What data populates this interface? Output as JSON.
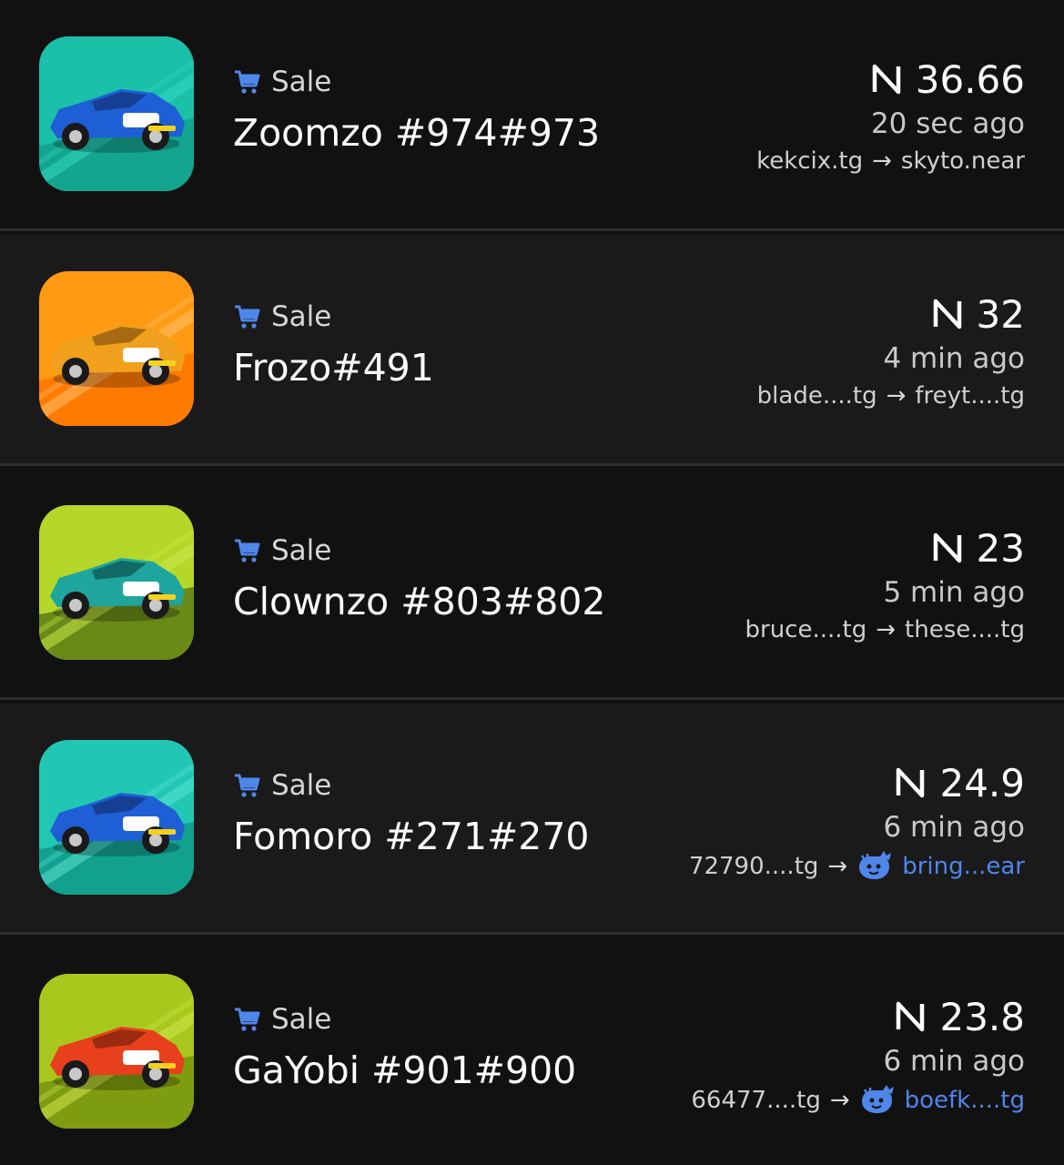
{
  "activity": {
    "items": [
      {
        "type_label": "Sale",
        "name": "Zoomzo #974#973",
        "price": "36.66",
        "time": "20 sec ago",
        "from": "kekcix.tg",
        "to": "skyto.near",
        "to_link": false,
        "thumb": {
          "bg": "#1bc0a8",
          "bg2": "#14a591",
          "car": "#1f5fd6",
          "car_dark": "#163f94",
          "stripe": "#2fd8bf"
        }
      },
      {
        "type_label": "Sale",
        "name": "Frozo#491",
        "price": "32",
        "time": "4 min ago",
        "from": "blade....tg",
        "to": "freyt....tg",
        "to_link": false,
        "thumb": {
          "bg": "#ff9a12",
          "bg2": "#ff7a00",
          "car": "#f0a01c",
          "car_dark": "#a86a10",
          "stripe": "#ffc06a"
        }
      },
      {
        "type_label": "Sale",
        "name": "Clownzo #803#802",
        "price": "23",
        "time": "5 min ago",
        "from": "bruce....tg",
        "to": "these....tg",
        "to_link": false,
        "thumb": {
          "bg": "#b5d72a",
          "bg2": "#6a8a18",
          "car": "#1ea59e",
          "car_dark": "#126a66",
          "stripe": "#cbe84a"
        }
      },
      {
        "type_label": "Sale",
        "name": "Fomoro #271#270",
        "price": "24.9",
        "time": "6 min ago",
        "from": "72790....tg",
        "to": "bring...ear",
        "to_link": true,
        "thumb": {
          "bg": "#22c7b4",
          "bg2": "#12a08f",
          "car": "#1f5fd6",
          "car_dark": "#163f94",
          "stripe": "#5ae2d2"
        }
      },
      {
        "type_label": "Sale",
        "name": "GaYobi #901#900",
        "price": "23.8",
        "time": "6 min ago",
        "from": "66477....tg",
        "to": "boefk....tg",
        "to_link": true,
        "thumb": {
          "bg": "#a8c81e",
          "bg2": "#7e9c10",
          "car": "#e8401c",
          "car_dark": "#9a2a10",
          "stripe": "#cfe64a"
        }
      }
    ]
  },
  "icons": {
    "type": "cart-icon",
    "currency": "near-icon",
    "transfer_arrow": "arrow-right-icon",
    "wallet": "whale-icon"
  },
  "colors": {
    "background": "#111111",
    "row_alt": "#1a1a1a",
    "divider": "#2e2e2e",
    "accent_blue": "#4f86ea"
  }
}
